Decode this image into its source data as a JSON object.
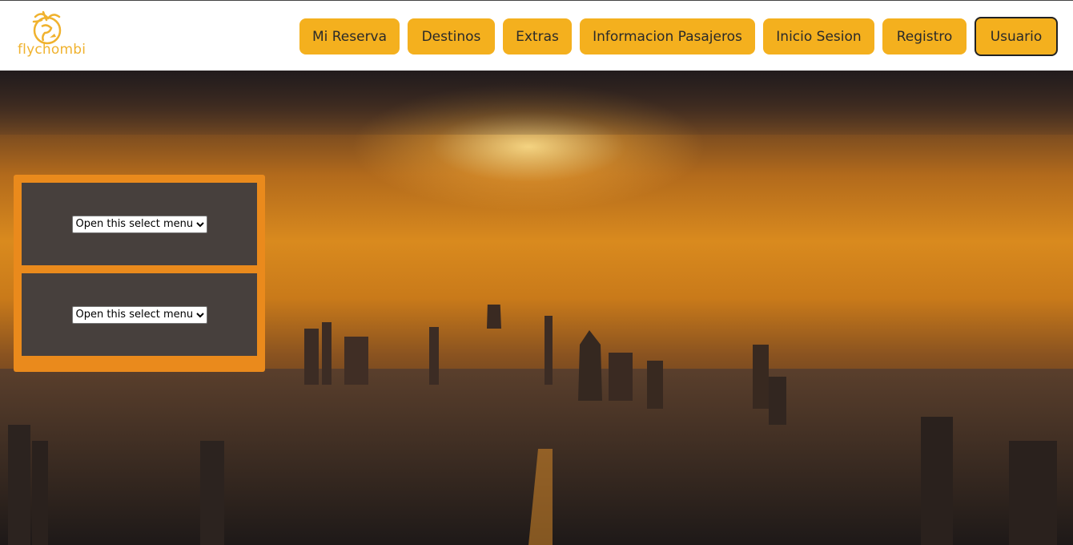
{
  "brand": {
    "name": "flychombi",
    "color": "#f0b22e"
  },
  "nav": {
    "items": [
      {
        "label": "Mi Reserva"
      },
      {
        "label": "Destinos"
      },
      {
        "label": "Extras"
      },
      {
        "label": "Informacion Pasajeros"
      },
      {
        "label": "Inicio Sesion"
      },
      {
        "label": "Registro"
      },
      {
        "label": "Usuario"
      }
    ],
    "button_color": "#f4b01e",
    "active": "Usuario"
  },
  "panel": {
    "color": "#ea8a1c",
    "selects": [
      {
        "selected": "Open this select menu"
      },
      {
        "selected": "Open this select menu"
      }
    ]
  }
}
